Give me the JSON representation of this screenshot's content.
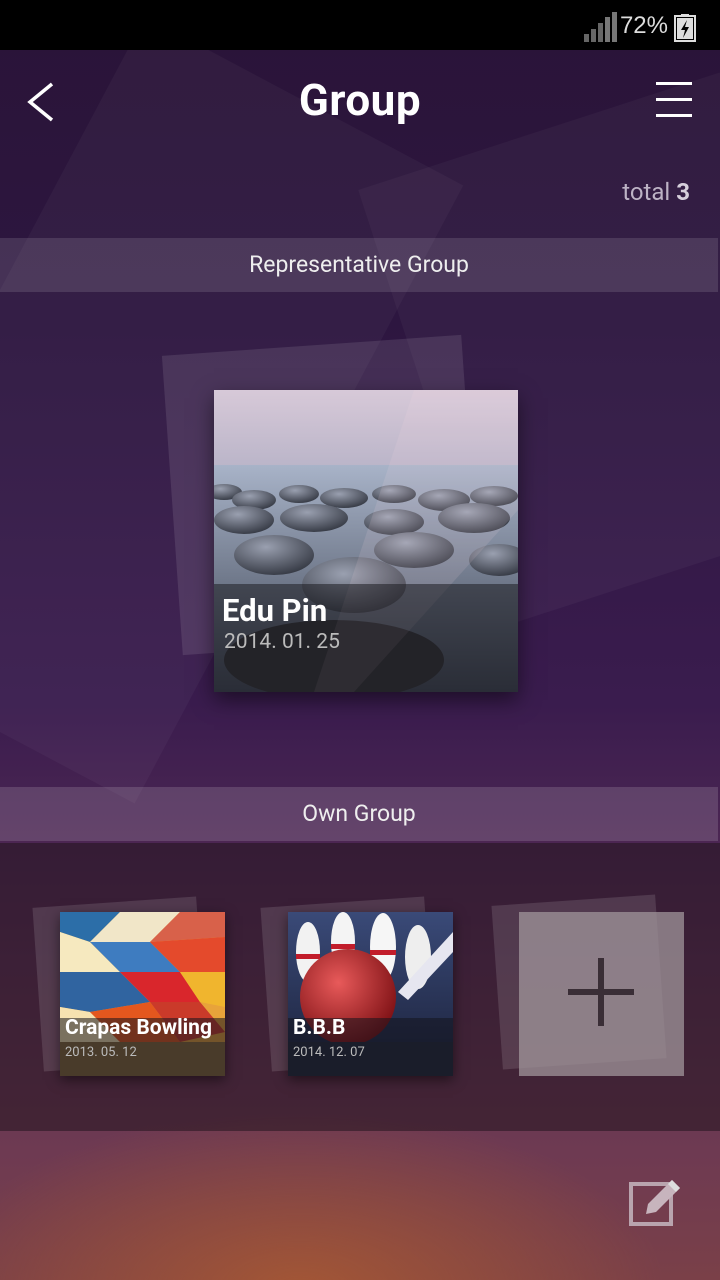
{
  "status": {
    "battery": "72%"
  },
  "header": {
    "title": "Group"
  },
  "total": {
    "label": "total",
    "count": "3"
  },
  "sections": {
    "representative": "Representative Group",
    "own": "Own Group"
  },
  "representative_group": {
    "name": "Edu Pin",
    "date": "2014. 01. 25"
  },
  "own_groups": [
    {
      "name": "Crapas Bowling",
      "date": "2013. 05. 12"
    },
    {
      "name": "B.B.B",
      "date": "2014. 12. 07"
    }
  ]
}
